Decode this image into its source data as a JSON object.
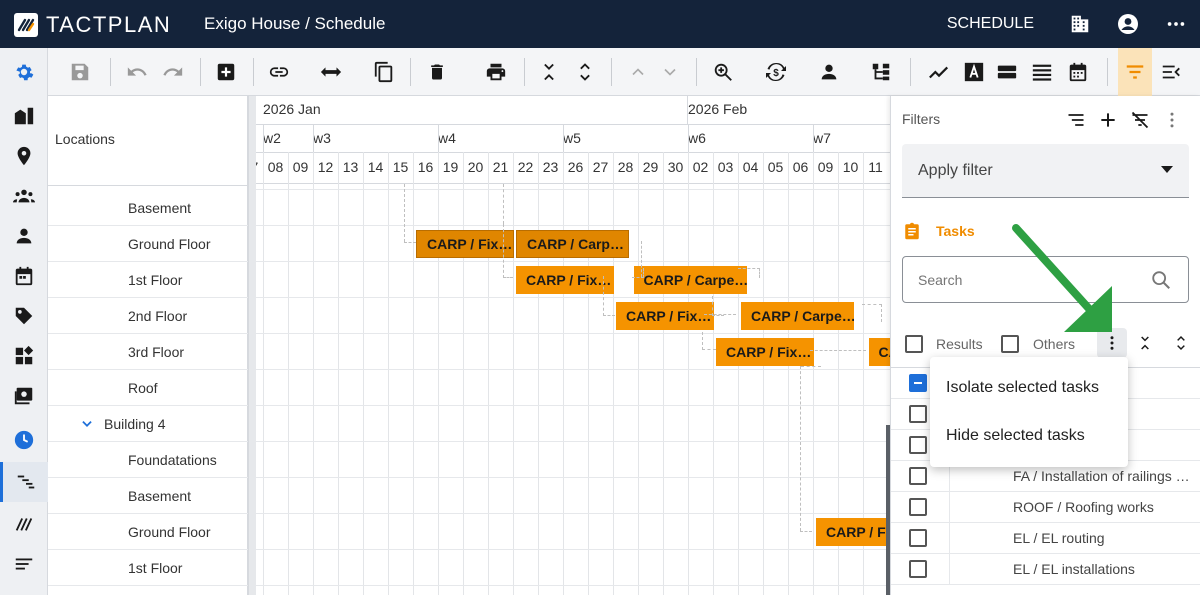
{
  "app": {
    "logo_text": "TACTPLAN",
    "title": "Exigo House / Schedule",
    "mode_label": "SCHEDULE"
  },
  "locations": {
    "header": "Locations",
    "rows": [
      {
        "label": "Basement",
        "indent": 2
      },
      {
        "label": "Ground Floor",
        "indent": 2
      },
      {
        "label": "1st Floor",
        "indent": 2
      },
      {
        "label": "2nd Floor",
        "indent": 2
      },
      {
        "label": "3rd Floor",
        "indent": 2
      },
      {
        "label": "Roof",
        "indent": 2
      },
      {
        "label": "Building 4",
        "indent": 1,
        "expanded": true
      },
      {
        "label": "Foundatations",
        "indent": 2
      },
      {
        "label": "Basement",
        "indent": 2
      },
      {
        "label": "Ground Floor",
        "indent": 2
      },
      {
        "label": "1st Floor",
        "indent": 2
      }
    ]
  },
  "timeline": {
    "months": [
      {
        "label": "2026 Jan",
        "col": 0
      },
      {
        "label": "2026 Feb",
        "col": 17
      }
    ],
    "weeks": [
      {
        "label": "w2",
        "col": 0
      },
      {
        "label": "w3",
        "col": 2
      },
      {
        "label": "w4",
        "col": 7
      },
      {
        "label": "w5",
        "col": 12
      },
      {
        "label": "w6",
        "col": 17
      },
      {
        "label": "w7",
        "col": 22
      }
    ],
    "days": [
      "08",
      "09",
      "12",
      "13",
      "14",
      "15",
      "16",
      "19",
      "20",
      "21",
      "22",
      "23",
      "26",
      "27",
      "28",
      "29",
      "30",
      "02",
      "03",
      "04",
      "05",
      "06",
      "09",
      "10",
      "11"
    ],
    "leading_day": "07"
  },
  "bars": [
    {
      "label": "CARP / Fix…",
      "row": 1,
      "col": 6,
      "span": 4,
      "dark": true
    },
    {
      "label": "CARP / Carp…",
      "row": 1,
      "col": 10,
      "span": 4.6,
      "dark": true
    },
    {
      "label": "CARP / Fix…",
      "row": 2,
      "col": 10,
      "span": 4
    },
    {
      "label": "CARP / Carpe…",
      "row": 2,
      "col": 14.7,
      "span": 4.6
    },
    {
      "label": "CARP / Fix…",
      "row": 3,
      "col": 14,
      "span": 4
    },
    {
      "label": "CARP / Carpe…",
      "row": 3,
      "col": 19,
      "span": 4.6
    },
    {
      "label": "CARP / Fix…",
      "row": 4,
      "col": 18,
      "span": 4
    },
    {
      "label": "CA",
      "row": 4,
      "col": 24.1,
      "span": 1.5
    },
    {
      "label": "CARP / Fix",
      "row": 9,
      "col": 22,
      "span": 3.4
    }
  ],
  "filters": {
    "title": "Filters",
    "apply_filter": "Apply filter",
    "tasks_label": "Tasks",
    "search_placeholder": "Search",
    "results_label": "Results",
    "others_label": "Others",
    "tasks": [
      "",
      "",
      "",
      "FA / Installation of railings …",
      "ROOF / Roofing works",
      "EL / EL routing",
      "EL / EL installations"
    ]
  },
  "context_menu": {
    "items": [
      "Isolate selected tasks",
      "Hide selected tasks"
    ]
  },
  "colors": {
    "topbar": "#14233a",
    "bar": "#f59300",
    "bar_dark": "#e08600",
    "tasks_accent": "#f08c00",
    "arrow": "#2ea043",
    "checkbox_active": "#1e6fd9"
  }
}
